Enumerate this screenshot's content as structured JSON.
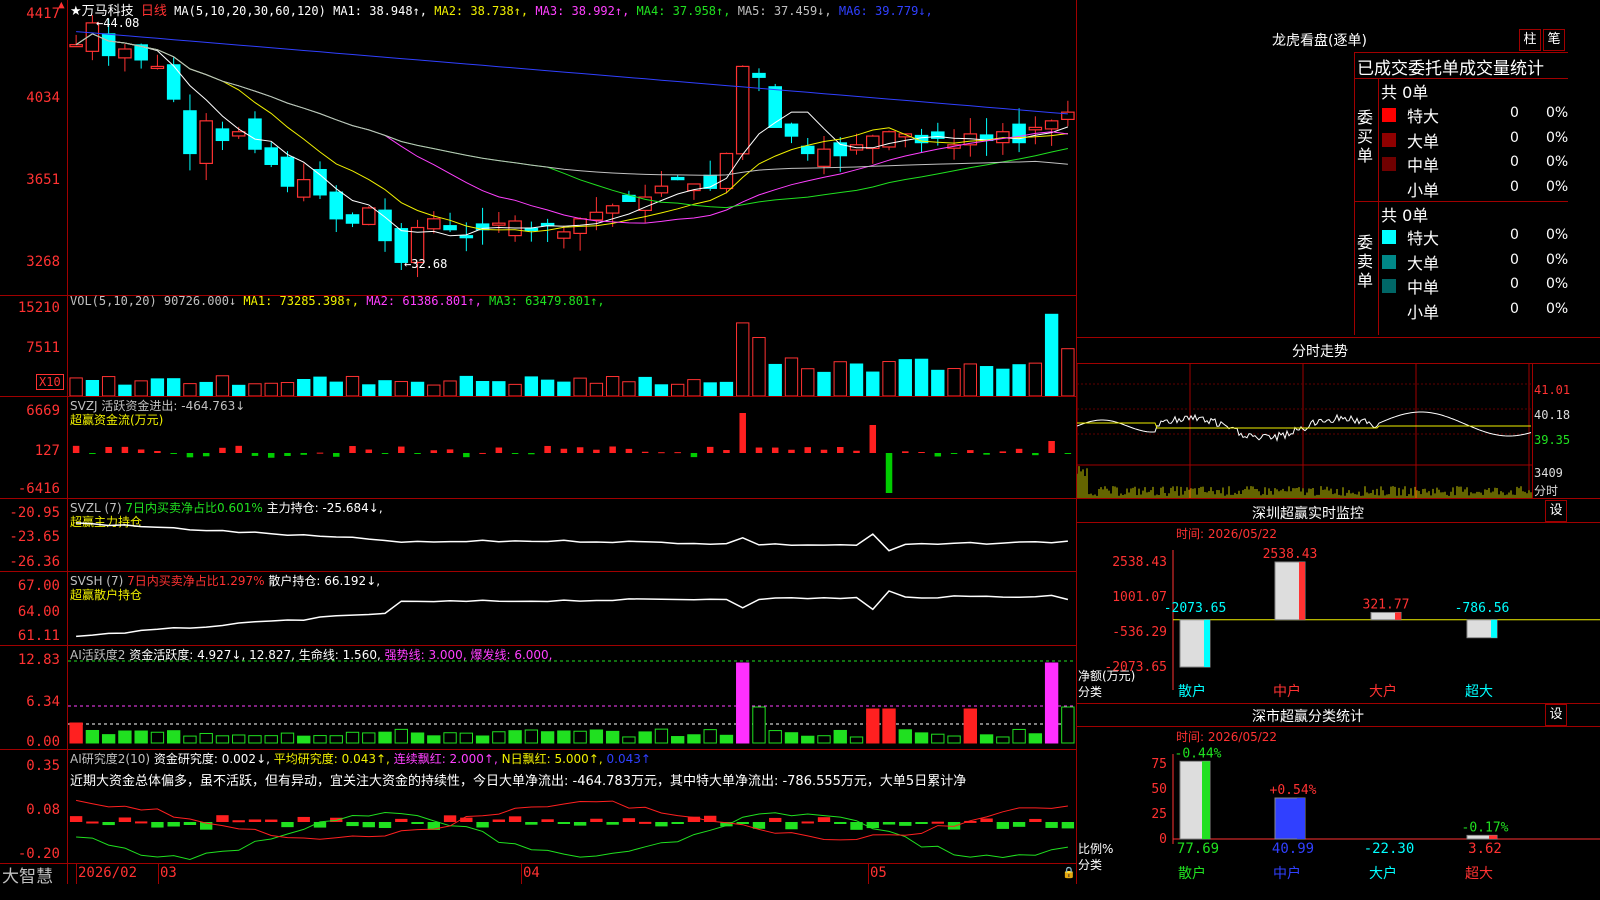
{
  "main": {
    "stock_name": "★万马科技",
    "period": "日线",
    "ma_params": "MA(5,10,20,30,60,120)",
    "ma": [
      {
        "label": "MA1: 38.948↑",
        "color": "#ffffff"
      },
      {
        "label": "MA2: 38.738↑",
        "color": "#f0f000"
      },
      {
        "label": "MA3: 38.992↑",
        "color": "#ff40ff"
      },
      {
        "label": "MA4: 37.958↑",
        "color": "#20e020"
      },
      {
        "label": "MA5: 37.459↓",
        "color": "#c0c0c0"
      },
      {
        "label": "MA6: 39.779↓",
        "color": "#3040ff"
      }
    ],
    "y_ticks": [
      "4417",
      "4034",
      "3651",
      "3268"
    ],
    "high_label": "←44.08",
    "low_label": "←32.68",
    "arrow_label": "▲"
  },
  "vol": {
    "title": "VOL(5,10,20) 90726.000↓",
    "ma": [
      {
        "label": "MA1: 73285.398↑",
        "color": "#f0f000"
      },
      {
        "label": "MA2: 61386.801↑",
        "color": "#ff40ff"
      },
      {
        "label": "MA3: 63479.801↑",
        "color": "#20e020"
      }
    ],
    "y_ticks": [
      "15210",
      "7511"
    ],
    "unit": "X10"
  },
  "svzj": {
    "title": "SVZJ  活跃资金进出: -464.763↓",
    "sub": "超赢资金流(万元)",
    "y_ticks": [
      "6669",
      "127",
      "-6416"
    ]
  },
  "svzl": {
    "title_a": "SVZL (7)",
    "title_b": "7日内买卖净占比0.601%",
    "title_c": "主力持仓: -25.684↓,",
    "sub": "超赢主力持仓",
    "y_ticks": [
      "-20.95",
      "-23.65",
      "-26.36"
    ]
  },
  "svsh": {
    "title_a": "SVSH (7)",
    "title_b": "7日内买卖净占比1.297%",
    "title_c": "散户持仓: 66.192↓,",
    "sub": "超赢散户持仓",
    "y_ticks": [
      "67.00",
      "64.00",
      "61.11"
    ]
  },
  "ai1": {
    "title_a": "AI活跃度2",
    "title_b": "资金活跃度: 4.927↓, 12.827,",
    "title_c": "生命线: 1.560,",
    "title_d": "强势线: 3.000,",
    "title_e": "爆发线: 6.000,",
    "y_ticks": [
      "12.83",
      "6.34",
      "0.00"
    ]
  },
  "ai2": {
    "title_a": "AI研究度2(10)",
    "title_b": "资金研究度: 0.002↓,",
    "title_c": "平均研究度: 0.043↑,",
    "title_d": "连续飘红: 2.000↑,",
    "title_e": "N日飘红: 5.000↑,",
    "title_f": "0.043↑",
    "note": "近期大资金总体偏多，虽不活跃，但有异动，宜关注大资金的持续性，今日大单净流出: -464.783万元，其中特大单净流出: -786.555万元，大单5日累计净",
    "y_ticks": [
      "0.35",
      "0.08",
      "-0.20"
    ]
  },
  "bottom": {
    "brand": "大智慧",
    "dates": [
      "2026/02",
      "03",
      "04",
      "05"
    ]
  },
  "right": {
    "lhb_title": "龙虎看盘(逐单)",
    "btn_zhu": "柱",
    "btn_bi": "笔",
    "tabs": "已成交委托单成交量统计",
    "buy": {
      "side": "委买单",
      "total": "共 0单",
      "rows": [
        {
          "name": "特大",
          "count": "0",
          "pct": "0%",
          "color": "#ff0000"
        },
        {
          "name": "大单",
          "count": "0",
          "pct": "0%",
          "color": "#900000"
        },
        {
          "name": "中单",
          "count": "0",
          "pct": "0%",
          "color": "#700000"
        },
        {
          "name": "小单",
          "count": "0",
          "pct": "0%",
          "color": "#000000"
        }
      ]
    },
    "sell": {
      "side": "委卖单",
      "total": "共 0单",
      "rows": [
        {
          "name": "特大",
          "count": "0",
          "pct": "0%",
          "color": "#00ffff"
        },
        {
          "name": "大单",
          "count": "0",
          "pct": "0%",
          "color": "#008888"
        },
        {
          "name": "中单",
          "count": "0",
          "pct": "0%",
          "color": "#006666"
        },
        {
          "name": "小单",
          "count": "0",
          "pct": "0%",
          "color": "#000000"
        }
      ]
    },
    "fenshi": {
      "title": "分时走势",
      "y_ticks": [
        "41.01",
        "40.18",
        "39.35"
      ],
      "vol_tick": "3409",
      "vol_label": "分时"
    },
    "szcy": {
      "title": "深圳超赢实时监控",
      "btn": "设",
      "time": "时间: 2026/05/22",
      "y_ticks": [
        "2538.43",
        "1001.07",
        "-536.29",
        "-2073.65"
      ],
      "ylabel": "净额(万元)",
      "xlabel": "分类",
      "categories": [
        "散户",
        "中户",
        "大户",
        "超大"
      ],
      "values": [
        -2073.65,
        2538.43,
        321.77,
        -786.56
      ],
      "value_labels": [
        "-2073.65",
        "2538.43",
        "321.77",
        "-786.56"
      ]
    },
    "szfl": {
      "title": "深市超赢分类统计",
      "btn": "设",
      "time": "时间: 2026/05/22",
      "y_ticks": [
        "75",
        "50",
        "25",
        "0"
      ],
      "ylabel": "比例%",
      "xlabel": "分类",
      "categories": [
        "散户",
        "中户",
        "大户",
        "超大"
      ],
      "top_labels": [
        "-0.44%",
        "+0.54%",
        "",
        "-0.17%"
      ],
      "bottom_labels": [
        "77.69",
        "40.99",
        "-22.30",
        "3.62"
      ]
    }
  }
}
